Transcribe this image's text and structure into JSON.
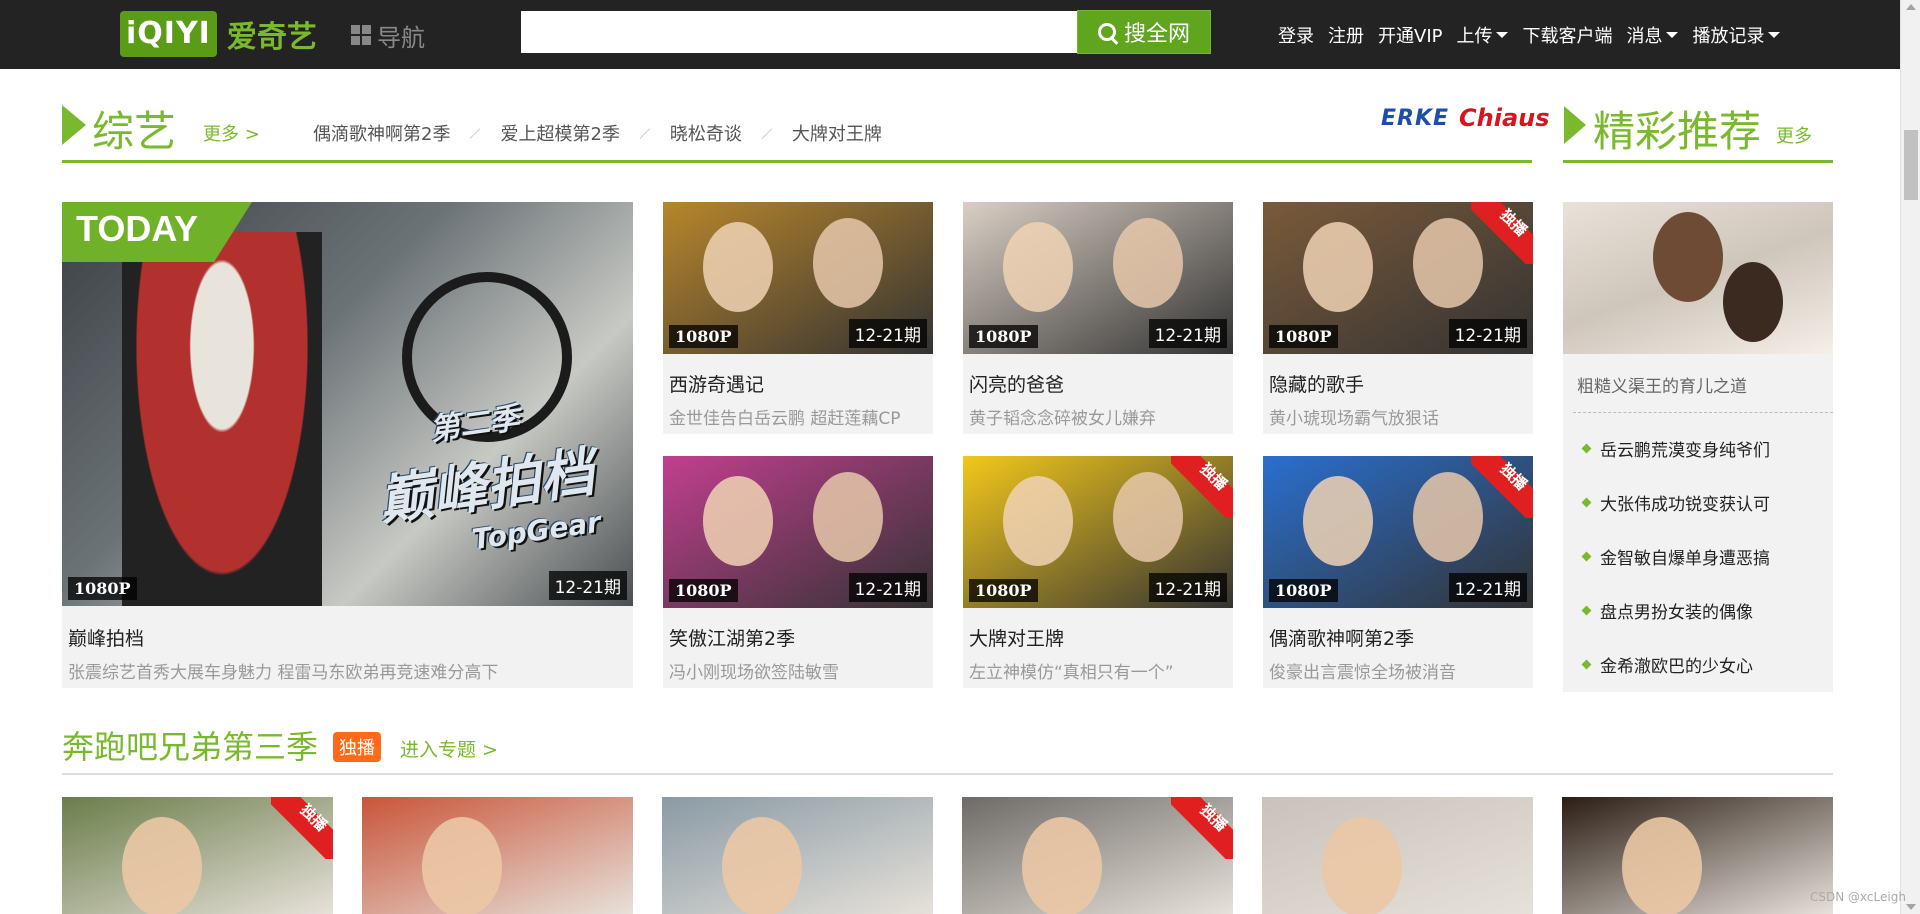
{
  "header": {
    "logo_box": "iQIYI",
    "logo_text": "爱奇艺",
    "nav_label": "导航",
    "search_placeholder": "",
    "search_button": "搜全网",
    "links": [
      "登录",
      "注册",
      "开通VIP",
      "上传",
      "下载客户端",
      "消息",
      "播放记录"
    ]
  },
  "variety": {
    "title": "综艺",
    "more": "更多 >",
    "tags": [
      "偶滴歌神啊第2季",
      "爱上超模第2季",
      "晓松奇谈",
      "大牌对王牌"
    ],
    "sponsor": [
      "ERKE",
      "Chiaus"
    ],
    "featured": {
      "today": "TODAY",
      "quality": "1080P",
      "episode": "12-21期",
      "title": "巅峰拍档",
      "desc": "张震综艺首秀大展车身魅力 程雷马东欧弟再竞速难分高下",
      "show_logo": "巅峰拍档",
      "show_logo_sub": "TopGear",
      "show_logo_badge": "第二季"
    },
    "cards": [
      {
        "title": "西游奇遇记",
        "desc": "金世佳告白岳云鹏 超赶莲藕CP",
        "quality": "1080P",
        "episode": "12-21期",
        "exclusive": false,
        "thumb_color": "#b8862c"
      },
      {
        "title": "闪亮的爸爸",
        "desc": "黄子韬念念碎被女儿嫌弃",
        "quality": "1080P",
        "episode": "12-21期",
        "exclusive": false,
        "thumb_color": "#d9cfc4"
      },
      {
        "title": "隐藏的歌手",
        "desc": "黄小琥现场霸气放狠话",
        "quality": "1080P",
        "episode": "12-21期",
        "exclusive": true,
        "exclusive_label": "独播",
        "thumb_color": "#7a5a3a"
      },
      {
        "title": "笑傲江湖第2季",
        "desc": "冯小刚现场欲签陆敏雪",
        "quality": "1080P",
        "episode": "12-21期",
        "exclusive": false,
        "thumb_color": "#c23f8f"
      },
      {
        "title": "大牌对王牌",
        "desc": "左立神模仿“真相只有一个”",
        "quality": "1080P",
        "episode": "12-21期",
        "exclusive": true,
        "exclusive_label": "独播",
        "thumb_color": "#f2c81b"
      },
      {
        "title": "偶滴歌神啊第2季",
        "desc": "俊豪出言震惊全场被消音",
        "quality": "1080P",
        "episode": "12-21期",
        "exclusive": true,
        "exclusive_label": "独播",
        "thumb_color": "#2a6fcf"
      }
    ]
  },
  "recommend": {
    "title": "精彩推荐",
    "more": "更多",
    "feature_caption": "粗糙义渠王的育儿之道",
    "items": [
      "岳云鹏荒漠变身纯爷们",
      "大张伟成功锐变获认可",
      "金智敏自爆单身遭恶搞",
      "盘点男扮女装的偶像",
      "金希澈欧巴的少女心"
    ]
  },
  "running_man": {
    "title": "奔跑吧兄弟第三季",
    "exclusive": "独播",
    "enter": "进入专题 >",
    "thumbs": [
      {
        "color": "#6b7d4a",
        "exclusive": true,
        "exclusive_label": "独播"
      },
      {
        "color": "#c9553a",
        "exclusive": false
      },
      {
        "color": "#8a9aa4",
        "exclusive": false
      },
      {
        "color": "#6e6a66",
        "exclusive": true,
        "exclusive_label": "独播"
      },
      {
        "color": "#c9c2bb",
        "exclusive": false
      },
      {
        "color": "#2b1d14",
        "exclusive": false
      }
    ]
  },
  "watermark": "CSDN @xcLeigh"
}
